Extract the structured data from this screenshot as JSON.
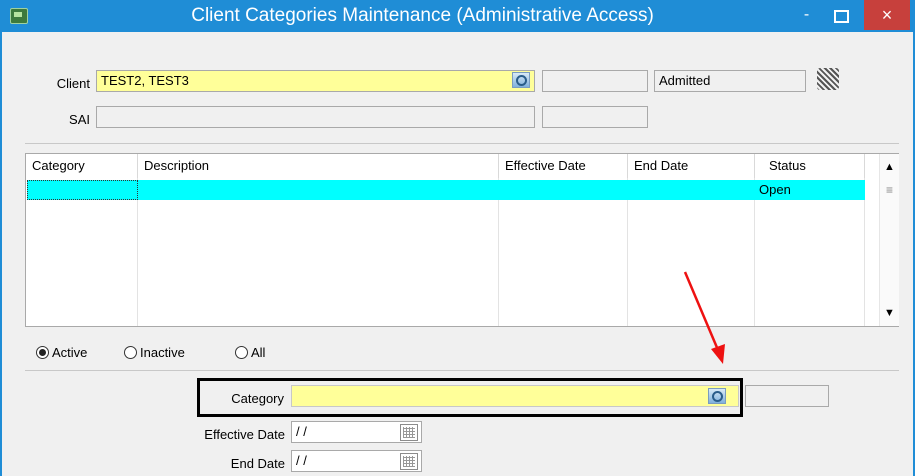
{
  "window": {
    "title": "Client Categories Maintenance (Administrative Access)",
    "minimize": "-",
    "close": "×"
  },
  "client": {
    "label": "Client",
    "value": "TEST2, TEST3",
    "status": "Admitted"
  },
  "sai": {
    "label": "SAI"
  },
  "grid": {
    "headers": [
      "Category",
      "Description",
      "Effective Date",
      "End Date",
      "Status"
    ],
    "rows": [
      {
        "category": "",
        "description": "",
        "effective_date": "",
        "end_date": "",
        "status": "Open"
      }
    ],
    "scroll_up": "▲",
    "scroll_down": "▼",
    "scroll_grip": "≡"
  },
  "filter": {
    "options": [
      "Active",
      "Inactive",
      "All"
    ],
    "selected": "Active"
  },
  "detail": {
    "category_label": "Category",
    "effective_date_label": "Effective Date",
    "effective_date_value": " / /",
    "end_date_label": "End Date",
    "end_date_value": " / /"
  },
  "colors": {
    "titlebar": "#1f8dd6",
    "close": "#c7403c",
    "selection": "#00ffff",
    "required": "#ffff99",
    "arrow": "#ee1111"
  }
}
